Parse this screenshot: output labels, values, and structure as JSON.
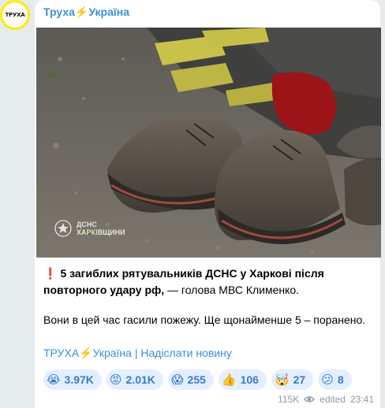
{
  "channel": {
    "avatar_text": "ТРУХА",
    "name": "Труха⚡Україна"
  },
  "photo": {
    "watermark_line1": "ДСНС",
    "watermark_line2": "ХАРКІВЩИНИ"
  },
  "post": {
    "alert_icon": "❗",
    "headline_bold": "5 загиблих рятувальників ДСНС у Харкові після повторного удару рф,",
    "headline_rest": " — голова МВС Клименко.",
    "body": "Вони в цей час гасили пожежу. Ще щонайменше 5 – поранено."
  },
  "footer": {
    "channel_link": "ТРУХА⚡Україна",
    "separator": " | ",
    "submit_link": "Надіслати новину"
  },
  "reactions": [
    {
      "emoji": "😭",
      "icon": "crying-face",
      "count": "3.97K"
    },
    {
      "emoji": "😡",
      "icon": "angry-face",
      "count": "2.01K"
    },
    {
      "emoji": "😱",
      "icon": "screaming-face",
      "count": "255"
    },
    {
      "emoji": "👍",
      "icon": "thumbs-up",
      "count": "106"
    },
    {
      "emoji": "🤯",
      "icon": "exploding-head",
      "count": "27"
    },
    {
      "emoji": "😕",
      "icon": "confused-face",
      "count": "8"
    }
  ],
  "meta": {
    "views": "115K",
    "edited": "edited",
    "time": "23:41"
  },
  "colors": {
    "link": "#3a8fd6",
    "reaction_bg": "#e3efff",
    "avatar_ring": "#ffeb00"
  }
}
